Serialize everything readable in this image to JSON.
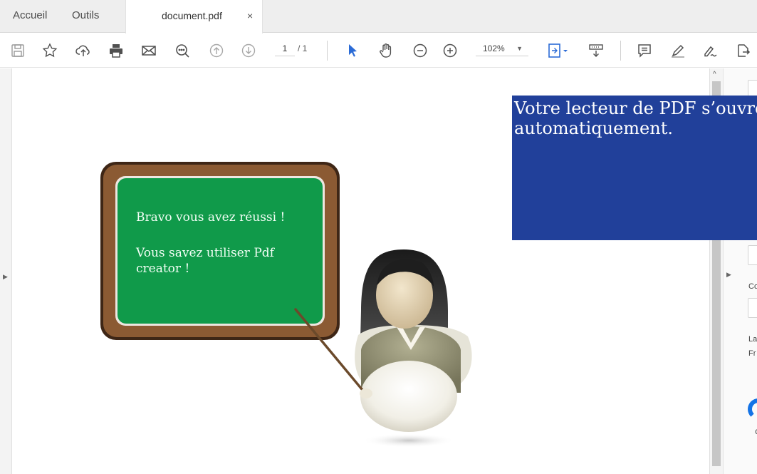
{
  "tabs": {
    "home": "Accueil",
    "tools": "Outils",
    "document": "document.pdf",
    "close": "×"
  },
  "toolbar": {
    "page_current": "1",
    "page_total": "/ 1",
    "zoom": "102%",
    "icons": [
      "save-icon",
      "bookmark-star-icon",
      "upload-cloud-icon",
      "print-icon",
      "mail-icon",
      "search-zoom-icon",
      "page-up-icon",
      "page-down-icon",
      "select-cursor-icon",
      "hand-icon",
      "zoom-out-icon",
      "zoom-in-icon",
      "page-fit-icon",
      "read-mode-icon",
      "comment-icon",
      "highlight-pen-icon",
      "sign-icon",
      "share-icon"
    ]
  },
  "document": {
    "board_line1": "Bravo vous avez réussi !",
    "board_line2": "Vous savez utiliser Pdf creator !"
  },
  "banner": {
    "text": "Votre lecteur de PDF s’ouvre automatiquement."
  },
  "right_panel": {
    "label_co": "Co",
    "label_la": "La",
    "label_fr": "Fr",
    "dot": "¢"
  },
  "colors": {
    "banner_bg": "#21409a",
    "board_green": "#109a4a",
    "frame_brown": "#8b5a33",
    "accent_blue": "#1473e6",
    "cursor_blue": "#2b6bd6"
  }
}
